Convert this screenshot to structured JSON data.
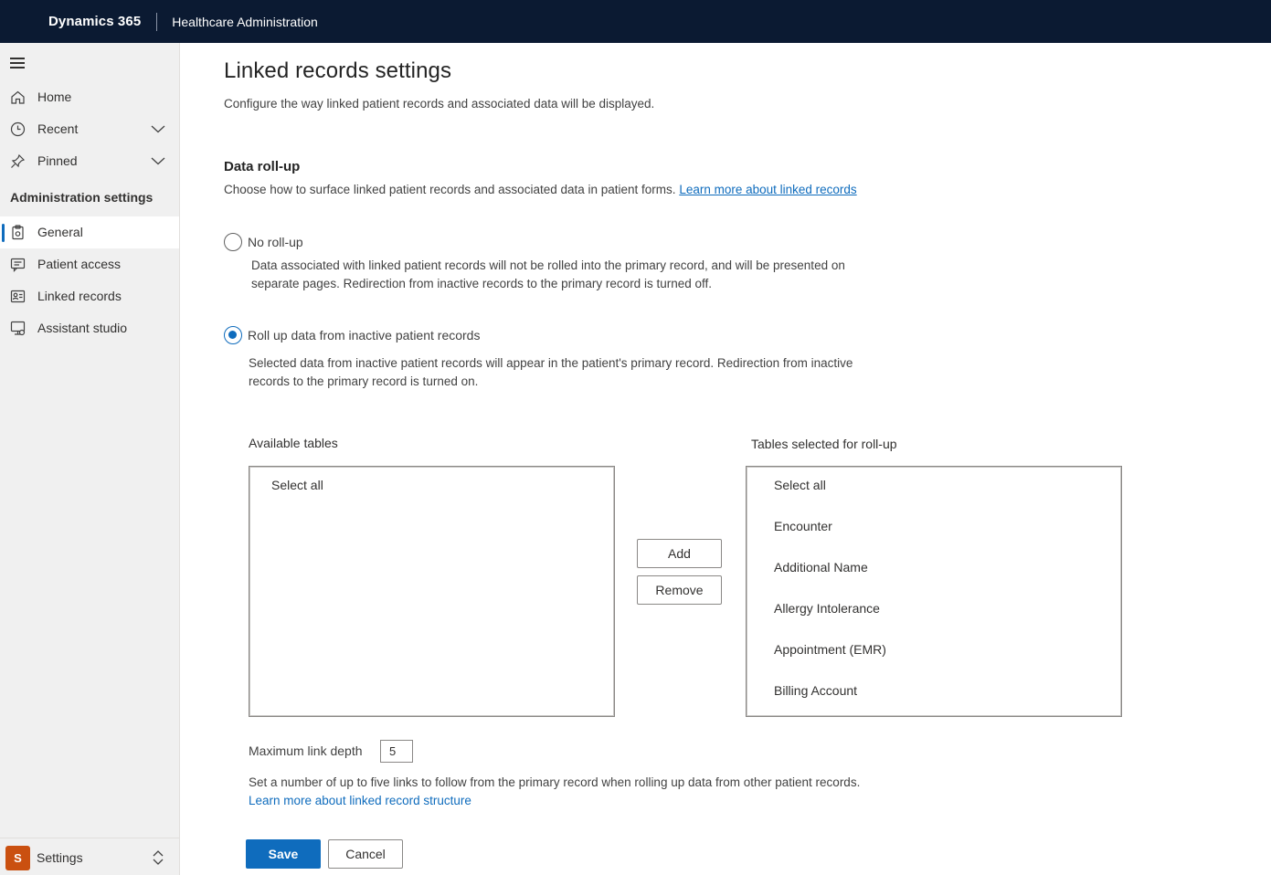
{
  "topbar": {
    "brand": "Dynamics 365",
    "app_name": "Healthcare Administration"
  },
  "sidebar": {
    "menu_icon": "hamburger-icon",
    "items": [
      {
        "label": "Home",
        "icon": "home-icon"
      },
      {
        "label": "Recent",
        "icon": "clock-icon",
        "expandable": true
      },
      {
        "label": "Pinned",
        "icon": "pin-icon",
        "expandable": true
      }
    ],
    "section_title": "Administration settings",
    "settings_items": [
      {
        "label": "General",
        "icon": "clipboard-settings-icon",
        "active": true
      },
      {
        "label": "Patient access",
        "icon": "chat-card-icon"
      },
      {
        "label": "Linked records",
        "icon": "contact-card-icon"
      },
      {
        "label": "Assistant studio",
        "icon": "bot-screen-icon"
      }
    ],
    "footer": {
      "avatar_letter": "S",
      "label": "Settings",
      "avatar_color": "#ca5010"
    }
  },
  "main": {
    "title": "Linked records settings",
    "description": "Configure the way linked patient records and associated data will be displayed.",
    "section": {
      "title": "Data roll-up",
      "description": "Choose how to surface linked patient records and associated data in patient forms.",
      "link": "Learn more about linked records"
    },
    "options": [
      {
        "label": "No roll-up",
        "checked": false,
        "description": "Data associated with linked patient records will not be rolled into the primary record, and will be presented on separate pages. Redirection from inactive records to the primary record is turned off."
      },
      {
        "label": "Roll up data from inactive patient records",
        "checked": true,
        "description": "Selected data from inactive patient records will appear in the patient's primary record. Redirection from inactive records to the primary record is turned on."
      }
    ],
    "available_tables": {
      "label": "Available tables",
      "items": [
        "Select all"
      ]
    },
    "selected_tables": {
      "label": "Tables selected for roll-up",
      "items": [
        "Select all",
        "Encounter",
        "Additional Name",
        "Allergy Intolerance",
        "Appointment (EMR)",
        "Billing Account"
      ]
    },
    "add_label": "Add",
    "remove_label": "Remove",
    "max_depth": {
      "label": "Maximum link depth",
      "value": "5",
      "description": "Set a number of up to five links to follow from the primary record when rolling up data from other patient records.",
      "link": "Learn more about linked record structure"
    },
    "save_label": "Save",
    "cancel_label": "Cancel",
    "accent_color": "#0f6cbd"
  }
}
